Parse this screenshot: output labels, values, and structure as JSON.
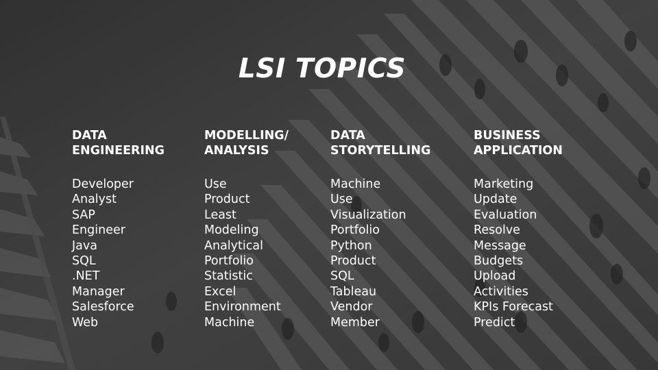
{
  "slide": {
    "title": "LSI TOPICS",
    "columns": [
      {
        "heading": "DATA\nENGINEERING",
        "items": [
          "Developer",
          "Analyst",
          "SAP",
          "Engineer",
          "Java",
          "SQL",
          ".NET",
          "Manager",
          "Salesforce",
          "Web"
        ]
      },
      {
        "heading": "MODELLING/\nANALYSIS",
        "items": [
          "Use",
          "Product",
          "Least",
          "Modeling",
          "Analytical",
          "Portfolio",
          "Statistic",
          "Excel",
          "Environment",
          "Machine"
        ]
      },
      {
        "heading": "DATA\nSTORYTELLING",
        "items": [
          "Machine",
          "Use",
          "Visualization",
          "Portfolio",
          "Python",
          "Product",
          "SQL",
          "Tableau",
          "Vendor",
          "Member"
        ]
      },
      {
        "heading": "BUSINESS\nAPPLICATION",
        "items": [
          "Marketing",
          "Update",
          "Evaluation",
          "Resolve",
          "Message",
          "Budgets",
          "Upload",
          "Activities",
          "KPIs Forecast",
          "Predict"
        ]
      }
    ]
  },
  "background": {
    "base_color": "#4a4a4a",
    "stripe_color": "#6e6e6e",
    "description_icon": "crosswalk-photo"
  }
}
